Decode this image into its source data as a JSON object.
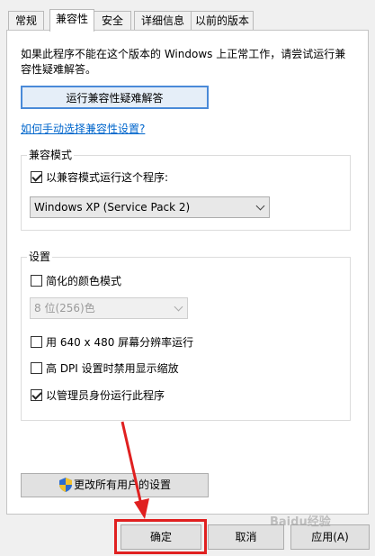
{
  "tabs": [
    "常规",
    "兼容性",
    "安全",
    "详细信息",
    "以前的版本"
  ],
  "active_tab": "兼容性",
  "intro_text_line1": "如果此程序不能在这个版本的 Windows 上正常工作，请尝试运行兼",
  "intro_text_line2": "容性疑难解答。",
  "troubleshooter_button": "运行兼容性疑难解答",
  "manual_link": "如何手动选择兼容性设置?",
  "compat_mode": {
    "title": "兼容模式",
    "checkbox_label": "以兼容模式运行这个程序:",
    "checked": true,
    "selected_os": "Windows XP (Service Pack 2)"
  },
  "settings": {
    "title": "设置",
    "reduced_color": {
      "label": "简化的颜色模式",
      "checked": false
    },
    "color_select": "8 位(256)色",
    "res_640": {
      "label": "用 640 x 480 屏幕分辨率运行",
      "checked": false
    },
    "high_dpi": {
      "label": "高 DPI 设置时禁用显示缩放",
      "checked": false
    },
    "run_as_admin": {
      "label": "以管理员身份运行此程序",
      "checked": true
    }
  },
  "change_all_users_button": "更改所有用户的设置",
  "footer": {
    "ok": "确定",
    "cancel": "取消",
    "apply": "应用(A)"
  },
  "watermark": "Baidu经验",
  "colors": {
    "link": "#0066cc",
    "highlight_box": "#e02020",
    "arrow": "#e02020"
  }
}
